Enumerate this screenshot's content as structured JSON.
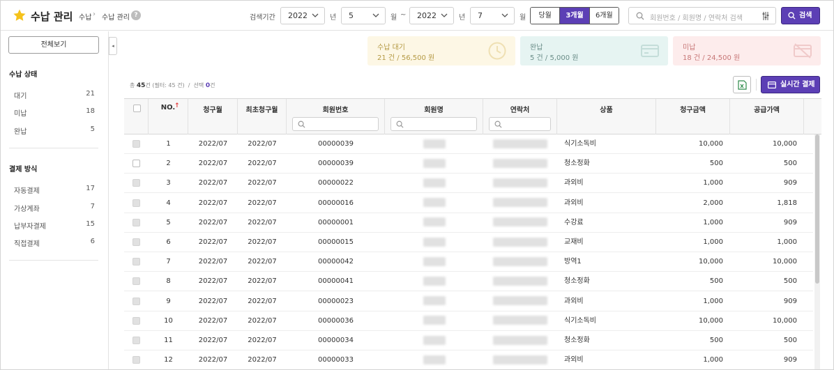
{
  "header": {
    "title": "수납 관리",
    "breadcrumb": [
      "수납",
      "수납 관리"
    ],
    "help_glyph": "?",
    "period_label": "검색기간",
    "from_year": "2022",
    "from_month": "5",
    "to_year": "2022",
    "to_month": "7",
    "unit_year": "년",
    "unit_month": "월",
    "range_sep": "~",
    "range_buttons": [
      "당월",
      "3개월",
      "6개월"
    ],
    "range_selected": "3개월",
    "search_placeholder": "회원번호 / 회원명 / 연락처 검색",
    "search_button": "검색",
    "accent_color": "#5c3fb5"
  },
  "sidebar": {
    "all_button": "전체보기",
    "collapse_glyph": "◂",
    "status_title": "수납 상태",
    "status_items": [
      {
        "label": "대기",
        "count": "21"
      },
      {
        "label": "미납",
        "count": "18"
      },
      {
        "label": "완납",
        "count": "5"
      }
    ],
    "payment_title": "결제 방식",
    "payment_items": [
      {
        "label": "자동결제",
        "count": "17"
      },
      {
        "label": "가상계좌",
        "count": "7"
      },
      {
        "label": "납부자결제",
        "count": "15"
      },
      {
        "label": "직접결제",
        "count": "6"
      }
    ]
  },
  "cards": [
    {
      "label": "수납 대기",
      "value": "21 건 / 56,500 원",
      "icon": "clock-icon"
    },
    {
      "label": "완납",
      "value": "5 건 / 5,000 원",
      "icon": "card-icon"
    },
    {
      "label": "미납",
      "value": "18 건 / 24,500 원",
      "icon": "card-off-icon"
    }
  ],
  "summary": {
    "total_prefix": "총",
    "total": "45",
    "total_suffix": "건 (필터: 45 건)",
    "divider": "/",
    "selected_prefix": "선택",
    "selected": "0",
    "selected_suffix": "건"
  },
  "toolbar": {
    "excel_icon": "excel-icon",
    "pay_button": "실시간 결제"
  },
  "table": {
    "columns": [
      "",
      "NO.",
      "청구월",
      "최초청구월",
      "회원번호",
      "회원명",
      "연락처",
      "상품",
      "청구금액",
      "공급가액"
    ],
    "sort_glyph": "↑",
    "rows": [
      {
        "no": "1",
        "bill_month": "2022/07",
        "first_month": "2022/07",
        "member_no": "00000039",
        "product": "식기소독비",
        "amount": "10,000",
        "supply": "10,000",
        "checkbox_disabled": true
      },
      {
        "no": "2",
        "bill_month": "2022/07",
        "first_month": "2022/07",
        "member_no": "00000039",
        "product": "청소정화",
        "amount": "500",
        "supply": "500",
        "checkbox_disabled": false
      },
      {
        "no": "3",
        "bill_month": "2022/07",
        "first_month": "2022/07",
        "member_no": "00000022",
        "product": "과외비",
        "amount": "1,000",
        "supply": "909",
        "checkbox_disabled": true
      },
      {
        "no": "4",
        "bill_month": "2022/07",
        "first_month": "2022/07",
        "member_no": "00000016",
        "product": "과외비",
        "amount": "2,000",
        "supply": "1,818",
        "checkbox_disabled": true
      },
      {
        "no": "5",
        "bill_month": "2022/07",
        "first_month": "2022/07",
        "member_no": "00000001",
        "product": "수강료",
        "amount": "1,000",
        "supply": "909",
        "checkbox_disabled": true
      },
      {
        "no": "6",
        "bill_month": "2022/07",
        "first_month": "2022/07",
        "member_no": "00000015",
        "product": "교재비",
        "amount": "1,000",
        "supply": "1,000",
        "checkbox_disabled": true
      },
      {
        "no": "7",
        "bill_month": "2022/07",
        "first_month": "2022/07",
        "member_no": "00000042",
        "product": "방역1",
        "amount": "10,000",
        "supply": "10,000",
        "checkbox_disabled": true
      },
      {
        "no": "8",
        "bill_month": "2022/07",
        "first_month": "2022/07",
        "member_no": "00000041",
        "product": "청소정화",
        "amount": "500",
        "supply": "500",
        "checkbox_disabled": true
      },
      {
        "no": "9",
        "bill_month": "2022/07",
        "first_month": "2022/07",
        "member_no": "00000023",
        "product": "과외비",
        "amount": "1,000",
        "supply": "909",
        "checkbox_disabled": true
      },
      {
        "no": "10",
        "bill_month": "2022/07",
        "first_month": "2022/07",
        "member_no": "00000036",
        "product": "식기소독비",
        "amount": "10,000",
        "supply": "10,000",
        "checkbox_disabled": true
      },
      {
        "no": "11",
        "bill_month": "2022/07",
        "first_month": "2022/07",
        "member_no": "00000034",
        "product": "청소정화",
        "amount": "500",
        "supply": "500",
        "checkbox_disabled": true
      },
      {
        "no": "12",
        "bill_month": "2022/07",
        "first_month": "2022/07",
        "member_no": "00000033",
        "product": "과외비",
        "amount": "1,000",
        "supply": "909",
        "checkbox_disabled": true
      }
    ]
  }
}
